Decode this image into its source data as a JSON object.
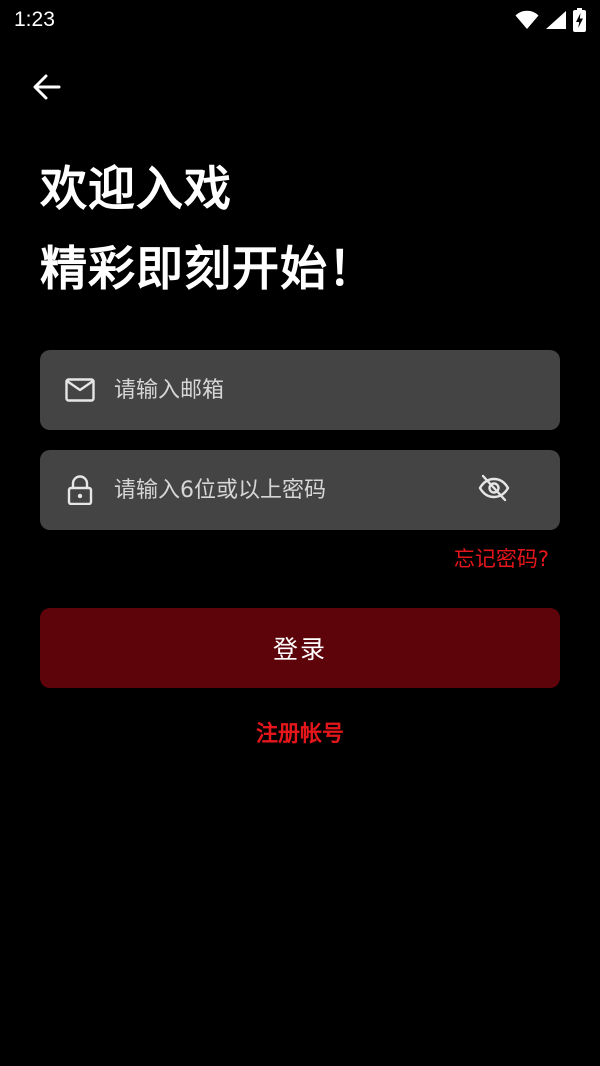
{
  "status_bar": {
    "time": "1:23",
    "icons": [
      "wifi-icon",
      "cellular-signal-icon",
      "battery-charging-icon"
    ]
  },
  "header": {
    "back_icon": "arrow-left-icon"
  },
  "headline": {
    "line1": "欢迎入戏",
    "line2": "精彩即刻开始！"
  },
  "form": {
    "email": {
      "icon": "mail-icon",
      "placeholder": "请输入邮箱",
      "value": ""
    },
    "password": {
      "icon": "lock-icon",
      "placeholder": "请输入6位或以上密码",
      "value": "",
      "toggle_icon": "eye-off-icon"
    },
    "forgot_label": "忘记密码?",
    "login_label": "登录",
    "register_label": "注册帐号"
  },
  "colors": {
    "background": "#000000",
    "field_background": "#444444",
    "accent_red": "#e5161b",
    "login_button": "#5c0409"
  }
}
